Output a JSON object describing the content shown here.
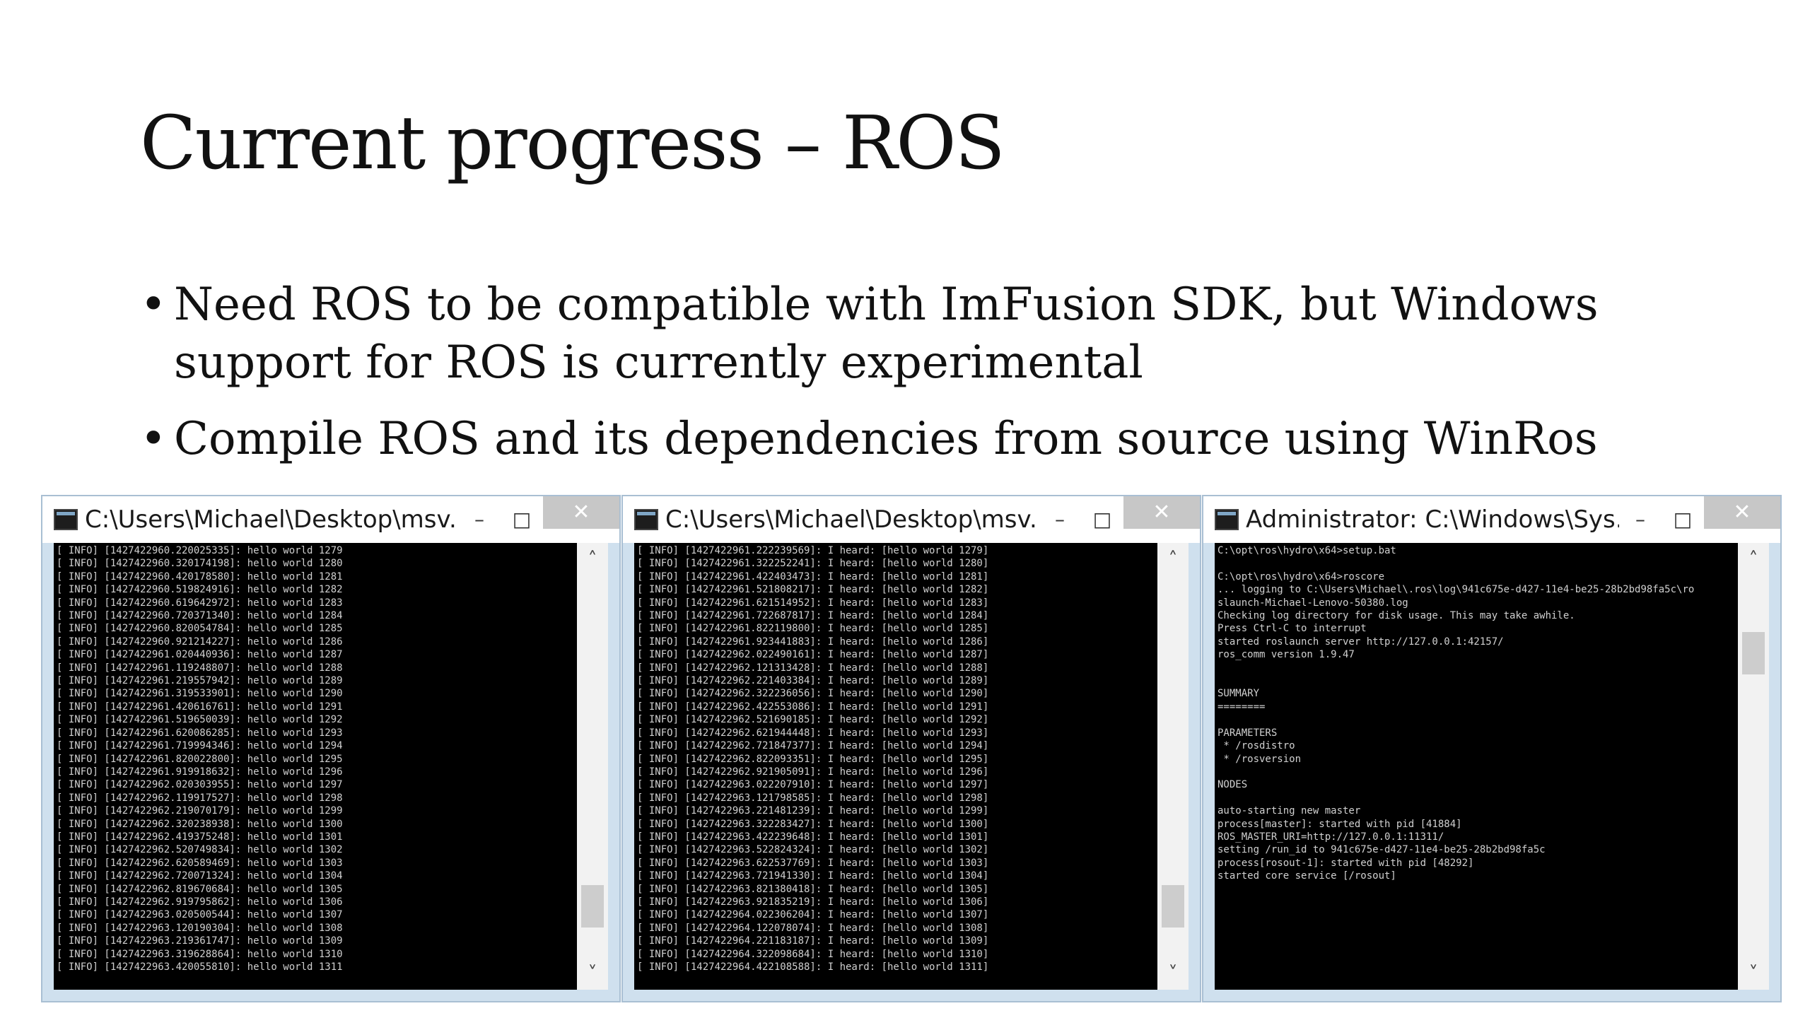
{
  "title": "Current progress – ROS",
  "bullets": [
    "Need ROS to be compatible with ImFusion SDK, but Windows support for ROS is currently experimental",
    "Compile ROS and its dependencies from source using WinRos"
  ],
  "bullet_glyph": "•",
  "controls": {
    "minimize": "–",
    "maximize": "□",
    "close": "✕"
  },
  "scroll": {
    "up": "˄",
    "down": "˅"
  },
  "windows": [
    {
      "title": "C:\\Users\\Michael\\Desktop\\msv...",
      "scroll_position": 0.92,
      "lines": [
        "[ INFO] [1427422960.220025335]: hello world 1279",
        "[ INFO] [1427422960.320174198]: hello world 1280",
        "[ INFO] [1427422960.420178580]: hello world 1281",
        "[ INFO] [1427422960.519824916]: hello world 1282",
        "[ INFO] [1427422960.619642972]: hello world 1283",
        "[ INFO] [1427422960.720371340]: hello world 1284",
        "[ INFO] [1427422960.820054784]: hello world 1285",
        "[ INFO] [1427422960.921214227]: hello world 1286",
        "[ INFO] [1427422961.020440936]: hello world 1287",
        "[ INFO] [1427422961.119248807]: hello world 1288",
        "[ INFO] [1427422961.219557942]: hello world 1289",
        "[ INFO] [1427422961.319533901]: hello world 1290",
        "[ INFO] [1427422961.420616761]: hello world 1291",
        "[ INFO] [1427422961.519650039]: hello world 1292",
        "[ INFO] [1427422961.620086285]: hello world 1293",
        "[ INFO] [1427422961.719994346]: hello world 1294",
        "[ INFO] [1427422961.820022800]: hello world 1295",
        "[ INFO] [1427422961.919918632]: hello world 1296",
        "[ INFO] [1427422962.020303955]: hello world 1297",
        "[ INFO] [1427422962.119917527]: hello world 1298",
        "[ INFO] [1427422962.219070179]: hello world 1299",
        "[ INFO] [1427422962.320238938]: hello world 1300",
        "[ INFO] [1427422962.419375248]: hello world 1301",
        "[ INFO] [1427422962.520749834]: hello world 1302",
        "[ INFO] [1427422962.620589469]: hello world 1303",
        "[ INFO] [1427422962.720071324]: hello world 1304",
        "[ INFO] [1427422962.819670684]: hello world 1305",
        "[ INFO] [1427422962.919795862]: hello world 1306",
        "[ INFO] [1427422963.020500544]: hello world 1307",
        "[ INFO] [1427422963.120190304]: hello world 1308",
        "[ INFO] [1427422963.219361747]: hello world 1309",
        "[ INFO] [1427422963.319628864]: hello world 1310",
        "[ INFO] [1427422963.420055810]: hello world 1311"
      ]
    },
    {
      "title": "C:\\Users\\Michael\\Desktop\\msv...",
      "scroll_position": 0.92,
      "lines": [
        "[ INFO] [1427422961.222239569]: I heard: [hello world 1279]",
        "[ INFO] [1427422961.322252241]: I heard: [hello world 1280]",
        "[ INFO] [1427422961.422403473]: I heard: [hello world 1281]",
        "[ INFO] [1427422961.521808217]: I heard: [hello world 1282]",
        "[ INFO] [1427422961.621514952]: I heard: [hello world 1283]",
        "[ INFO] [1427422961.722687817]: I heard: [hello world 1284]",
        "[ INFO] [1427422961.822119800]: I heard: [hello world 1285]",
        "[ INFO] [1427422961.923441883]: I heard: [hello world 1286]",
        "[ INFO] [1427422962.022490161]: I heard: [hello world 1287]",
        "[ INFO] [1427422962.121313428]: I heard: [hello world 1288]",
        "[ INFO] [1427422962.221403384]: I heard: [hello world 1289]",
        "[ INFO] [1427422962.322236056]: I heard: [hello world 1290]",
        "[ INFO] [1427422962.422553086]: I heard: [hello world 1291]",
        "[ INFO] [1427422962.521690185]: I heard: [hello world 1292]",
        "[ INFO] [1427422962.621944448]: I heard: [hello world 1293]",
        "[ INFO] [1427422962.721847377]: I heard: [hello world 1294]",
        "[ INFO] [1427422962.822093351]: I heard: [hello world 1295]",
        "[ INFO] [1427422962.921905091]: I heard: [hello world 1296]",
        "[ INFO] [1427422963.022207910]: I heard: [hello world 1297]",
        "[ INFO] [1427422963.121798585]: I heard: [hello world 1298]",
        "[ INFO] [1427422963.221481239]: I heard: [hello world 1299]",
        "[ INFO] [1427422963.322283427]: I heard: [hello world 1300]",
        "[ INFO] [1427422963.422239648]: I heard: [hello world 1301]",
        "[ INFO] [1427422963.522824324]: I heard: [hello world 1302]",
        "[ INFO] [1427422963.622537769]: I heard: [hello world 1303]",
        "[ INFO] [1427422963.721941330]: I heard: [hello world 1304]",
        "[ INFO] [1427422963.821380418]: I heard: [hello world 1305]",
        "[ INFO] [1427422963.921835219]: I heard: [hello world 1306]",
        "[ INFO] [1427422964.022306204]: I heard: [hello world 1307]",
        "[ INFO] [1427422964.122078074]: I heard: [hello world 1308]",
        "[ INFO] [1427422964.221183187]: I heard: [hello world 1309]",
        "[ INFO] [1427422964.322098684]: I heard: [hello world 1310]",
        "[ INFO] [1427422964.422108588]: I heard: [hello world 1311]"
      ]
    },
    {
      "title": "Administrator: C:\\Windows\\Sys...",
      "scroll_position": 0.16,
      "lines": [
        "C:\\opt\\ros\\hydro\\x64>setup.bat",
        "",
        "C:\\opt\\ros\\hydro\\x64>roscore",
        "... logging to C:\\Users\\Michael\\.ros\\log\\941c675e-d427-11e4-be25-28b2bd98fa5c\\ro",
        "slaunch-Michael-Lenovo-50380.log",
        "Checking log directory for disk usage. This may take awhile.",
        "Press Ctrl-C to interrupt",
        "started roslaunch server http://127.0.0.1:42157/",
        "ros_comm version 1.9.47",
        "",
        "",
        "SUMMARY",
        "========",
        "",
        "PARAMETERS",
        " * /rosdistro",
        " * /rosversion",
        "",
        "NODES",
        "",
        "auto-starting new master",
        "process[master]: started with pid [41884]",
        "ROS_MASTER_URI=http://127.0.0.1:11311/",
        "setting /run_id to 941c675e-d427-11e4-be25-28b2bd98fa5c",
        "process[rosout-1]: started with pid [48292]",
        "started core service [/rosout]"
      ]
    }
  ]
}
